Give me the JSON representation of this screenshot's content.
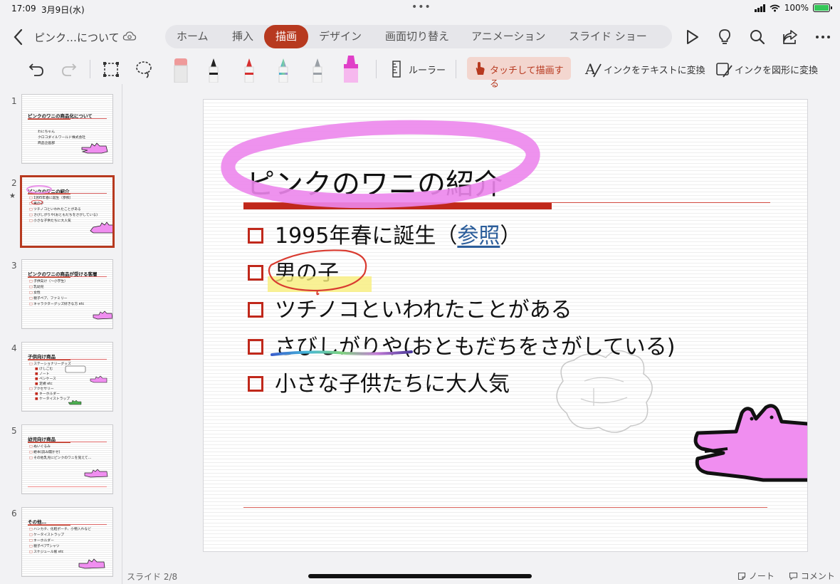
{
  "status": {
    "time": "17:09",
    "date": "3月9日(水)",
    "battery": "100%",
    "more": "•••"
  },
  "nav": {
    "back_icon": "chevron-left-icon",
    "doc_title": "ピンク…について",
    "tabs": [
      {
        "label": "ホーム"
      },
      {
        "label": "挿入"
      },
      {
        "label": "描画",
        "active": true
      },
      {
        "label": "デザイン"
      },
      {
        "label": "画面切り替え"
      },
      {
        "label": "アニメーション"
      },
      {
        "label": "スライド ショー"
      }
    ],
    "icons": [
      "play-icon",
      "lightbulb-icon",
      "search-icon",
      "share-icon",
      "more-icon"
    ]
  },
  "draw": {
    "ruler": "ルーラー",
    "touch_draw": "タッチして描画する",
    "ink_to_text": "インクをテキストに変換",
    "ink_to_shape": "インクを図形に変換",
    "pen_colors": [
      "#ef9a9a",
      "#222222",
      "#d62f2f",
      "#7bbcd9",
      "#9aa0a6",
      "#e040c8"
    ]
  },
  "thumbnails": [
    {
      "num": "1",
      "title": "ピンクのワニの商品化について",
      "lines": [
        "わにちゃん",
        "クロコダイルワールド株式会社",
        "商品企画部"
      ]
    },
    {
      "num": "2",
      "title": "ピンクのワニの紹介",
      "lines": [
        "1995年春に誕生（参照）",
        "男の子",
        "ツチノコといわれたことがある",
        "さびしがりや(おともだちをさがしている)",
        "小さな子供たちに大人気"
      ],
      "selected": true
    },
    {
      "num": "3",
      "title": "ピンクのワニの商品が受ける客層",
      "lines": [
        "子供向け（〜小学生）",
        "乳幼児",
        "女性",
        "親子ペア、ファミリー",
        "キャラクターグッズ好きな方 etc"
      ]
    },
    {
      "num": "4",
      "title": "子供向け商品",
      "lines": [
        "ステーショナリーグッズ",
        "けしごむ",
        "ノート",
        "ペンケース",
        "定規 etc",
        "アクセサリー",
        "キーホルダー",
        "ケータイストラップ"
      ]
    },
    {
      "num": "5",
      "title": "幼児向け商品",
      "lines": [
        "ぬいぐるみ",
        "絵本(読み聞かせ)",
        "その他乳児にピンクのワニを覚えて…"
      ]
    },
    {
      "num": "6",
      "title": "その他…",
      "lines": [
        "ハンカチ、化粧ポーチ、小物入れなど",
        "ケータイストラップ",
        "キーホルダー",
        "親子ペアTシャツ",
        "スケジュール帳 etc"
      ]
    }
  ],
  "slide": {
    "title": "ピンクのワニの紹介",
    "items": [
      {
        "pre": "1995年春に誕生（",
        "link": "参照",
        "post": "）"
      },
      {
        "pre": "男の子"
      },
      {
        "pre": "ツチノコといわれたことがある"
      },
      {
        "pre": "さびしがりや(おともだちをさがしている)"
      },
      {
        "pre": "小さな子供たちに大人気"
      }
    ]
  },
  "footer": {
    "slide_count": "スライド 2/8",
    "notes": "ノート",
    "comments": "コメント"
  }
}
